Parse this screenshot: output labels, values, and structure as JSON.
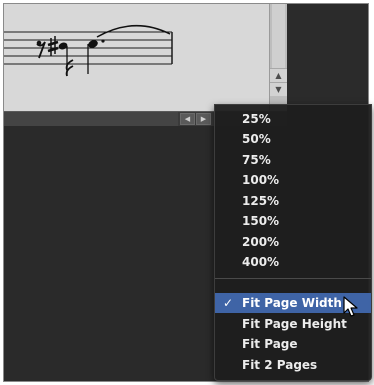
{
  "menu": {
    "zoom_levels": [
      "25%",
      "50%",
      "75%",
      "100%",
      "125%",
      "150%",
      "200%",
      "400%"
    ],
    "fit_options": [
      "Fit Page Width",
      "Fit Page Height",
      "Fit Page",
      "Fit 2 Pages"
    ],
    "selected": "Fit Page Width",
    "check_mark": "✓"
  },
  "scrollbars": {
    "up_icon": "triangle-up-icon",
    "down_icon": "triangle-down-icon",
    "left_icon": "triangle-left-icon",
    "right_icon": "triangle-right-icon"
  },
  "colors": {
    "menu_bg": "#1e1e1e",
    "highlight": "#3f64a6",
    "score_bg": "#d8d8d8",
    "dark_bg": "#2a2a2a"
  }
}
